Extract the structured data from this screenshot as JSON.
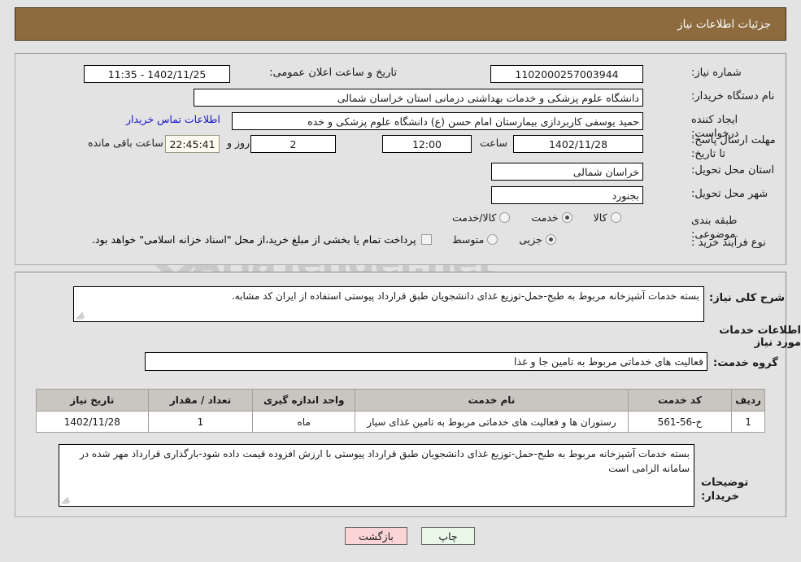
{
  "header": {
    "title": "جزئیات اطلاعات نیاز"
  },
  "top_form": {
    "need_number": {
      "label": "شماره نیاز:",
      "value": "1102000257003944"
    },
    "public_announce": {
      "label": "تاریخ و ساعت اعلان عمومی:",
      "value": "1402/11/25 - 11:35"
    },
    "buyer_org": {
      "label": "نام دستگاه خریدار:",
      "value": "دانشگاه علوم پزشکی و خدمات بهداشتی درمانی استان خراسان شمالی"
    },
    "requester": {
      "label": "ایجاد کننده درخواست:",
      "value": "حمید یوسفی کاربردازی بیمارستان امام حسن (ع) دانشگاه علوم پزشکی و خده",
      "contact_link": "اطلاعات تماس خریدار"
    },
    "deadline": {
      "label": "مهلت ارسال پاسخ: تا تاریخ:",
      "date": "1402/11/28",
      "hour_label": "ساعت",
      "hour": "12:00",
      "days": "2",
      "days_label": "روز و",
      "countdown": "22:45:41",
      "countdown_label": "ساعت باقی مانده"
    },
    "province": {
      "label": "استان محل تحویل:",
      "value": "خراسان شمالی"
    },
    "city": {
      "label": "شهر محل تحویل:",
      "value": "بجنورد"
    },
    "category": {
      "label": "طبقه بندی موضوعی:",
      "options": [
        {
          "text": "کالا",
          "selected": false
        },
        {
          "text": "خدمت",
          "selected": true
        },
        {
          "text": "کالا/خدمت",
          "selected": false
        }
      ]
    },
    "process_type": {
      "label": "نوع فرآیند خرید :",
      "options": [
        {
          "text": "جزیی",
          "selected": true
        },
        {
          "text": "متوسط",
          "selected": false
        }
      ],
      "checkbox": {
        "checked": false,
        "text": "پرداخت تمام یا بخشی از مبلغ خرید،از محل \"اسناد خزانه اسلامی\" خواهد بود."
      }
    }
  },
  "bottom": {
    "general_desc": {
      "label": "شرح کلی نیاز:",
      "value": "بسته خدمات آشپزخانه مربوط به طبخ-حمل-توزیع غذای دانشجویان طبق قرارداد پیوستی استفاده از ایران کد مشابه."
    },
    "services_heading": "اطلاعات خدمات مورد نیاز",
    "service_group": {
      "label": "گروه خدمت:",
      "value": "فعالیت های خدماتی مربوط به تامین جا و غذا"
    },
    "table": {
      "columns": [
        "ردیف",
        "کد خدمت",
        "نام خدمت",
        "واحد اندازه گیری",
        "تعداد / مقدار",
        "تاریخ نیاز"
      ],
      "rows": [
        {
          "row_no": "1",
          "service_code": "خ-56-561",
          "service_name": "رستوران ها و فعالیت های خدماتی مربوط به تامین غذای سیار",
          "unit": "ماه",
          "quantity": "1",
          "need_date": "1402/11/28"
        }
      ]
    },
    "buyer_notes": {
      "label": "توضیحات خریدار:",
      "value": "بسته خدمات آشپزخانه مربوط به طبخ-حمل-توزیع غذای دانشجویان طبق قرارداد پیوستی با ارزش افزوده قیمت داده شود-بارگذاری قرارداد مهر شده در سامانه الزامی است"
    }
  },
  "footer": {
    "print_label": "چاپ",
    "back_label": "بازگشت"
  },
  "watermark": {
    "text": "AriaTender.net",
    "accent": "V"
  },
  "colors": {
    "header_bar": "#8d6b3f",
    "page_bg": "#e3e3e3",
    "link": "#1414cc",
    "table_header": "#c9c6c1",
    "btn_back": "#fbd5d5",
    "btn_print": "#e9f7e9"
  }
}
